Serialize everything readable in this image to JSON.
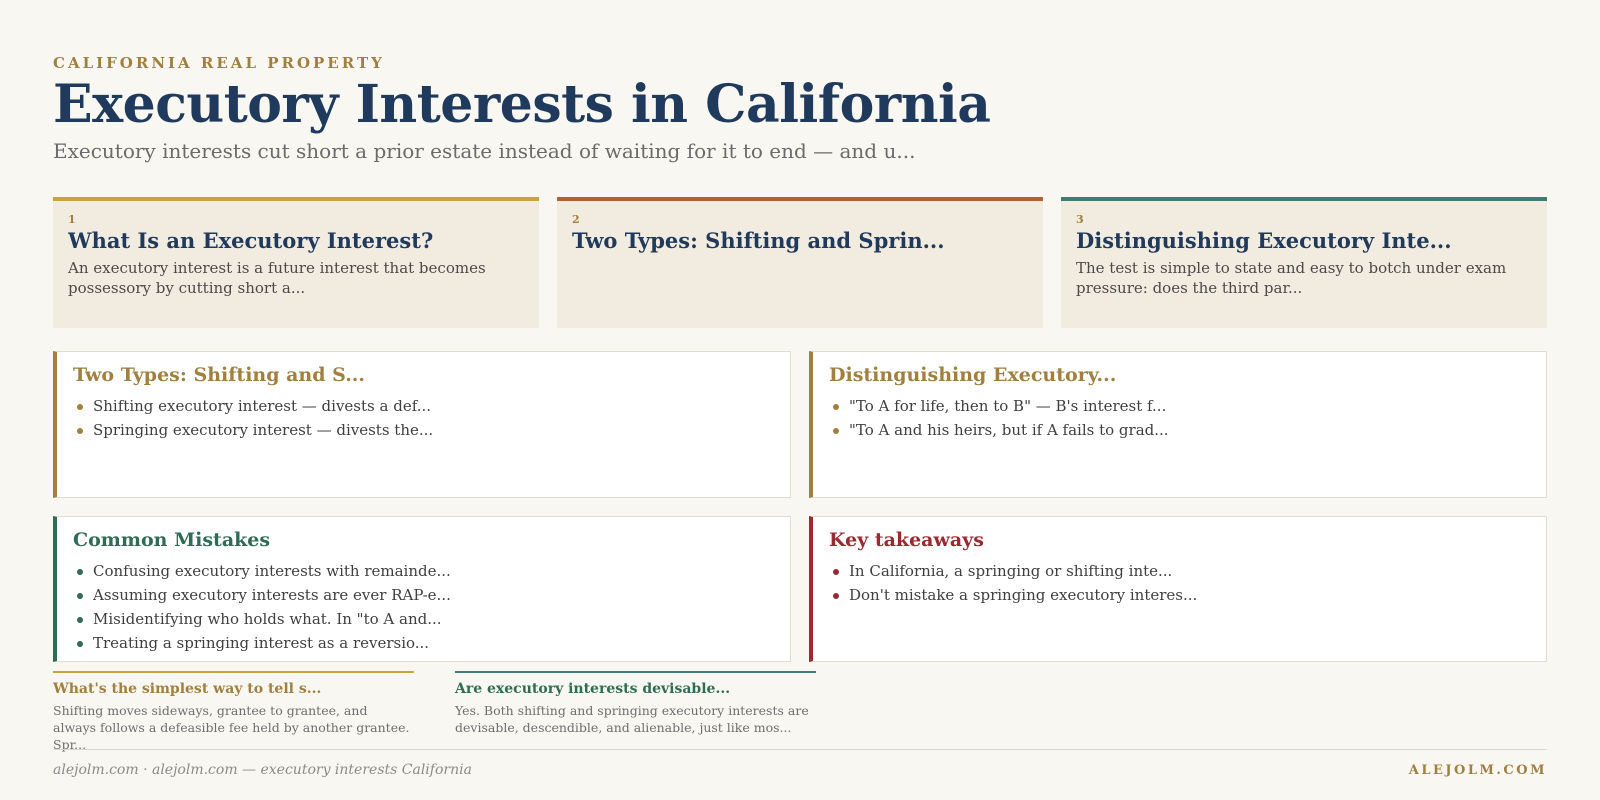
{
  "header": {
    "eyebrow": "CALIFORNIA REAL PROPERTY",
    "title": "Executory Interests in California",
    "subtitle": "Executory interests cut short a prior estate instead of waiting for it to end — and u..."
  },
  "cards": [
    {
      "number": "1",
      "title": "What Is an Executory Interest?",
      "body": "An executory interest is a future interest that becomes possessory by cutting short a...",
      "accent": "#c8a43c"
    },
    {
      "number": "2",
      "title": "Two Types: Shifting and Sprin...",
      "body": "",
      "accent": "#b65f34"
    },
    {
      "number": "3",
      "title": "Distinguishing Executory Inte...",
      "body": "The test is simple to state and easy to botch under exam pressure: does the third par...",
      "accent": "#3e7c79"
    }
  ],
  "panels": {
    "types": {
      "title": "Two Types: Shifting and S...",
      "items": [
        "Shifting executory interest — divests a def...",
        "Springing executory interest — divests the..."
      ]
    },
    "distinguishing": {
      "title": "Distinguishing Executory...",
      "items": [
        "\"To A for life, then to B\" — B's interest f...",
        "\"To A and his heirs, but if A fails to grad..."
      ]
    },
    "mistakes": {
      "title": "Common Mistakes",
      "items": [
        "Confusing executory interests with remainde...",
        "Assuming executory interests are ever RAP-e...",
        "Misidentifying who holds what. In \"to A and...",
        "Treating a springing interest as a reversio..."
      ]
    },
    "takeaways": {
      "title": "Key takeaways",
      "items": [
        "In California, a springing or shifting inte...",
        "Don't mistake a springing executory interes..."
      ]
    }
  },
  "faq": [
    {
      "question": "What's the simplest way to tell s...",
      "answer": "Shifting moves sideways, grantee to grantee, and always follows a defeasible fee held by another grantee. Spr..."
    },
    {
      "question": "Are executory interests devisable...",
      "answer": "Yes. Both shifting and springing executory interests are devisable, descendible, and alienable, just like mos..."
    }
  ],
  "footer": {
    "left": "alejolm.com · alejolm.com — executory interests California",
    "right": "ALEJOLM.COM"
  },
  "colors": {
    "navy": "#1f3a5c",
    "gold": "#a07f3f",
    "green": "#2f6b55",
    "crimson": "#9b2a30",
    "background": "#f9f7f2"
  }
}
